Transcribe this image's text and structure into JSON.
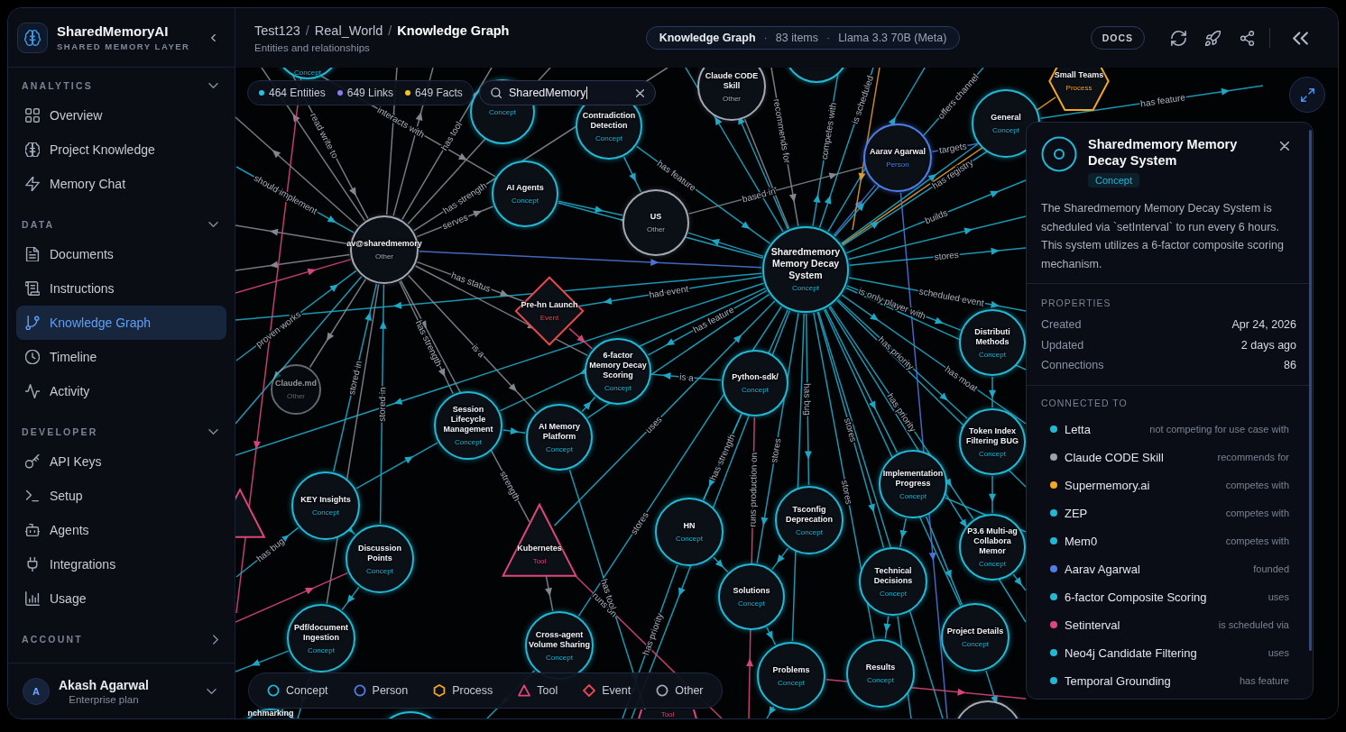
{
  "sidebar": {
    "brand": {
      "name": "SharedMemoryAI",
      "tagline": "SHARED MEMORY LAYER"
    },
    "sections": [
      {
        "title": "ANALYTICS",
        "expanded": true,
        "items": [
          {
            "label": "Overview",
            "selected": false
          },
          {
            "label": "Project Knowledge",
            "selected": false
          },
          {
            "label": "Memory Chat",
            "selected": false
          }
        ]
      },
      {
        "title": "DATA",
        "expanded": true,
        "items": [
          {
            "label": "Documents",
            "selected": false
          },
          {
            "label": "Instructions",
            "selected": false
          },
          {
            "label": "Knowledge Graph",
            "selected": true
          },
          {
            "label": "Timeline",
            "selected": false
          },
          {
            "label": "Activity",
            "selected": false
          }
        ]
      },
      {
        "title": "DEVELOPER",
        "expanded": true,
        "items": [
          {
            "label": "API Keys",
            "selected": false
          },
          {
            "label": "Setup",
            "selected": false
          },
          {
            "label": "Agents",
            "selected": false
          },
          {
            "label": "Integrations",
            "selected": false
          },
          {
            "label": "Usage",
            "selected": false
          }
        ]
      },
      {
        "title": "ACCOUNT",
        "expanded": false
      }
    ],
    "user": {
      "initial": "A",
      "name": "Akash Agarwal",
      "plan": "Enterprise plan"
    }
  },
  "header": {
    "breadcrumb": [
      {
        "label": "Test123",
        "current": false
      },
      {
        "separator": "/",
        "label": "Real_World",
        "current": false
      },
      {
        "separator": "/",
        "label": "Knowledge Graph",
        "current": true
      }
    ],
    "subtitle": "Entities and relationships",
    "context": [
      {
        "text": "Knowledge Graph"
      },
      {
        "separator": "·",
        "text": "83 items"
      },
      {
        "separator": "·",
        "text": "Llama 3.3 70B (Meta)"
      }
    ],
    "docs_button": "DOCS"
  },
  "graph": {
    "stats": [
      {
        "label": "464 Entities",
        "color": "#22c3e6"
      },
      {
        "label": "649 Links",
        "color": "#8b7cf6"
      },
      {
        "label": "649 Facts",
        "color": "#f5c518"
      }
    ],
    "search": {
      "value": "SharedMemory",
      "focused": true
    },
    "nodes": [
      {
        "kind": "concept",
        "dimmed": false
      },
      {
        "kind": "concept",
        "type": "Concept",
        "dimmed": false
      },
      {
        "kind": "other",
        "name": "Claude CODE Skill",
        "type": "Other",
        "dimmed": false
      },
      {
        "kind": "process",
        "name": "Small Teams",
        "type": "Process",
        "dimmed": false
      },
      {
        "kind": "concept",
        "type": "Concept",
        "dimmed": false
      },
      {
        "kind": "concept",
        "name": "Contradiction Detection",
        "type": "Concept",
        "dimmed": false
      },
      {
        "kind": "concept",
        "name": "General",
        "type": "Concept",
        "dimmed": false
      },
      {
        "kind": "person",
        "name": "Aarav Agarwal",
        "type": "Person",
        "dimmed": false
      },
      {
        "kind": "concept",
        "name": "AI Agents",
        "type": "Concept",
        "dimmed": false
      },
      {
        "kind": "other",
        "name": "US",
        "type": "Other",
        "dimmed": false
      },
      {
        "kind": "other",
        "name": "av@sharedmemory",
        "type": "Other",
        "dimmed": false
      },
      {
        "kind": "concept",
        "name": "Sharedmemory Memory Decay System",
        "type": "Concept",
        "dimmed": false
      },
      {
        "kind": "event",
        "name": "Pre-hn Launch",
        "type": "Event",
        "dimmed": false
      },
      {
        "kind": "concept",
        "name": "Distributi Methods",
        "type": "Concept",
        "dimmed": false
      },
      {
        "kind": "other",
        "name": "Claude.md",
        "type": "Other",
        "dimmed": true
      },
      {
        "kind": "concept",
        "name": "6-factor Memory Decay Scoring",
        "type": "Concept",
        "dimmed": false
      },
      {
        "kind": "concept",
        "name": "Python-sdk/",
        "type": "Concept",
        "dimmed": false
      },
      {
        "kind": "concept",
        "name": "Session Lifecycle Management",
        "type": "Concept",
        "dimmed": false
      },
      {
        "kind": "concept",
        "name": "AI Memory Platform",
        "type": "Concept",
        "dimmed": false
      },
      {
        "kind": "concept",
        "name": "Token Index Filtering BUG",
        "type": "Concept",
        "dimmed": false
      },
      {
        "kind": "concept",
        "name": "Implementation Progress",
        "type": "Concept",
        "dimmed": false
      },
      {
        "kind": "tool",
        "dimmed": false
      },
      {
        "kind": "concept",
        "name": "KEY Insights",
        "type": "Concept",
        "dimmed": false
      },
      {
        "kind": "concept",
        "name": "Discussion Points",
        "type": "Concept",
        "dimmed": false
      },
      {
        "kind": "tool",
        "name": "Kubernetes",
        "type": "Tool",
        "dimmed": false
      },
      {
        "kind": "concept",
        "name": "HN",
        "type": "Concept",
        "dimmed": false
      },
      {
        "kind": "concept",
        "name": "Tsconfig Deprecation",
        "type": "Concept",
        "dimmed": false
      },
      {
        "kind": "concept",
        "name": "P3.6 Multi-ag Collabora Memor",
        "type": "Concept",
        "dimmed": false
      },
      {
        "kind": "concept",
        "name": "Solutions",
        "type": "Concept",
        "dimmed": false
      },
      {
        "kind": "concept",
        "name": "Technical Decisions",
        "type": "Concept",
        "dimmed": false
      },
      {
        "kind": "concept",
        "name": "Pdf/document Ingestion",
        "type": "Concept",
        "dimmed": false
      },
      {
        "kind": "concept",
        "name": "Cross-agent Volume Sharing",
        "type": "Concept",
        "dimmed": false
      },
      {
        "kind": "concept",
        "name": "Project Details",
        "type": "Concept",
        "dimmed": false
      },
      {
        "kind": "concept",
        "name": "Problems",
        "type": "Concept",
        "dimmed": false
      },
      {
        "kind": "concept",
        "name": "Results",
        "type": "Concept",
        "dimmed": false
      },
      {
        "kind": "concept",
        "name": "nchmarking",
        "dimmed": false
      },
      {
        "kind": "concept",
        "dimmed": false
      },
      {
        "kind": "tool",
        "type": "Tool",
        "dimmed": false
      },
      {
        "kind": "other",
        "dimmed": false
      }
    ],
    "edges": [
      {
        "label": "read write to"
      },
      {
        "label": "interacts with"
      },
      {
        "label": "has tool"
      },
      {
        "label": "has strength"
      },
      {
        "label": "serves"
      },
      {
        "label": "should implement"
      },
      {
        "label": "has status"
      },
      {
        "label": "has strength"
      },
      {
        "label": "is a"
      },
      {
        "label": "proven works"
      },
      {
        "label": "stored in"
      },
      {
        "label": "stored in"
      },
      {
        "label": "has bug"
      },
      {
        "label": "strength"
      },
      {
        "label": "stores"
      },
      {
        "label": "runs on"
      },
      {
        "label": "has tool"
      },
      {
        "label": "has priority"
      },
      {
        "label": "has strength"
      },
      {
        "label": "runs production on"
      },
      {
        "label": "has bug"
      },
      {
        "label": "stores"
      },
      {
        "label": "stores"
      },
      {
        "label": "stores"
      },
      {
        "label": "has priority"
      },
      {
        "label": "has priority"
      },
      {
        "label": "is only player with"
      },
      {
        "label": "scheduled event"
      },
      {
        "label": "has moat"
      },
      {
        "label": "stores"
      },
      {
        "label": "builds"
      },
      {
        "label": "has registry"
      },
      {
        "label": "targets"
      },
      {
        "label": "competes with"
      },
      {
        "label": "recommends for"
      },
      {
        "label": "is scheduled"
      },
      {
        "label": "offers channel"
      },
      {
        "label": "has feature"
      },
      {
        "label": "had event"
      },
      {
        "label": "has feature"
      },
      {
        "label": "is a"
      },
      {
        "label": "uses"
      },
      {
        "label": "based in"
      },
      {
        "label": "has feature"
      }
    ],
    "legend": [
      {
        "kind": "concept",
        "label": "Concept"
      },
      {
        "kind": "person",
        "label": "Person"
      },
      {
        "kind": "process",
        "label": "Process"
      },
      {
        "kind": "tool",
        "label": "Tool"
      },
      {
        "kind": "event",
        "label": "Event"
      },
      {
        "kind": "other",
        "label": "Other"
      }
    ]
  },
  "details": {
    "title": "Sharedmemory Memory Decay System",
    "kind": "concept",
    "type": "Concept",
    "description": "The Sharedmemory Memory Decay System is scheduled via `setInterval` to run every 6 hours. This system utilizes a 6-factor composite scoring mechanism.",
    "properties_heading": "PROPERTIES",
    "properties": [
      {
        "label": "Created",
        "value": "Apr 24, 2026"
      },
      {
        "label": "Updated",
        "value": "2 days ago"
      },
      {
        "label": "Connections",
        "value": "86"
      }
    ],
    "connections_heading": "CONNECTED TO",
    "connections": [
      {
        "name": "Letta",
        "relation": "not competing for use case with",
        "color": "#22b8d4"
      },
      {
        "name": "Claude CODE Skill",
        "relation": "recommends for",
        "color": "#9ca3af"
      },
      {
        "name": "Supermemory.ai",
        "relation": "competes with",
        "color": "#f5a623"
      },
      {
        "name": "ZEP",
        "relation": "competes with",
        "color": "#22b8d4"
      },
      {
        "name": "Mem0",
        "relation": "competes with",
        "color": "#22b8d4"
      },
      {
        "name": "Aarav Agarwal",
        "relation": "founded",
        "color": "#4f7ee8"
      },
      {
        "name": "6-factor Composite Scoring",
        "relation": "uses",
        "color": "#22b8d4"
      },
      {
        "name": "Setinterval",
        "relation": "is scheduled via",
        "color": "#e0457b"
      },
      {
        "name": "Neo4j Candidate Filtering",
        "relation": "uses",
        "color": "#22b8d4"
      },
      {
        "name": "Temporal Grounding",
        "relation": "has feature",
        "color": "#22b8d4"
      }
    ]
  }
}
